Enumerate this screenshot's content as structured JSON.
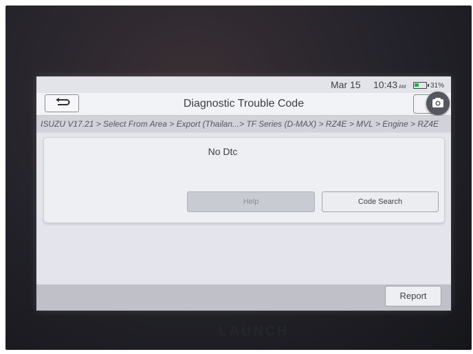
{
  "status": {
    "date": "Mar 15",
    "time": "10:43",
    "ampm": "AM",
    "battery": "31%"
  },
  "header": {
    "title": "Diagnostic Trouble Code"
  },
  "breadcrumb": "ISUZU V17.21 > Select From Area > Export (Thailan...> TF Series (D-MAX) > RZ4E > MVL > Engine > RZ4E",
  "content": {
    "message": "No Dtc",
    "help_label": "Help",
    "code_search_label": "Code Search"
  },
  "footer": {
    "report_label": "Report"
  },
  "device": {
    "brand": "LAUNCH"
  },
  "icons": {
    "back": "back-arrow-icon",
    "camera": "camera-icon",
    "battery": "battery-icon"
  },
  "colors": {
    "battery_level": "#22b14c",
    "screen_bg": "#dcdde5"
  }
}
